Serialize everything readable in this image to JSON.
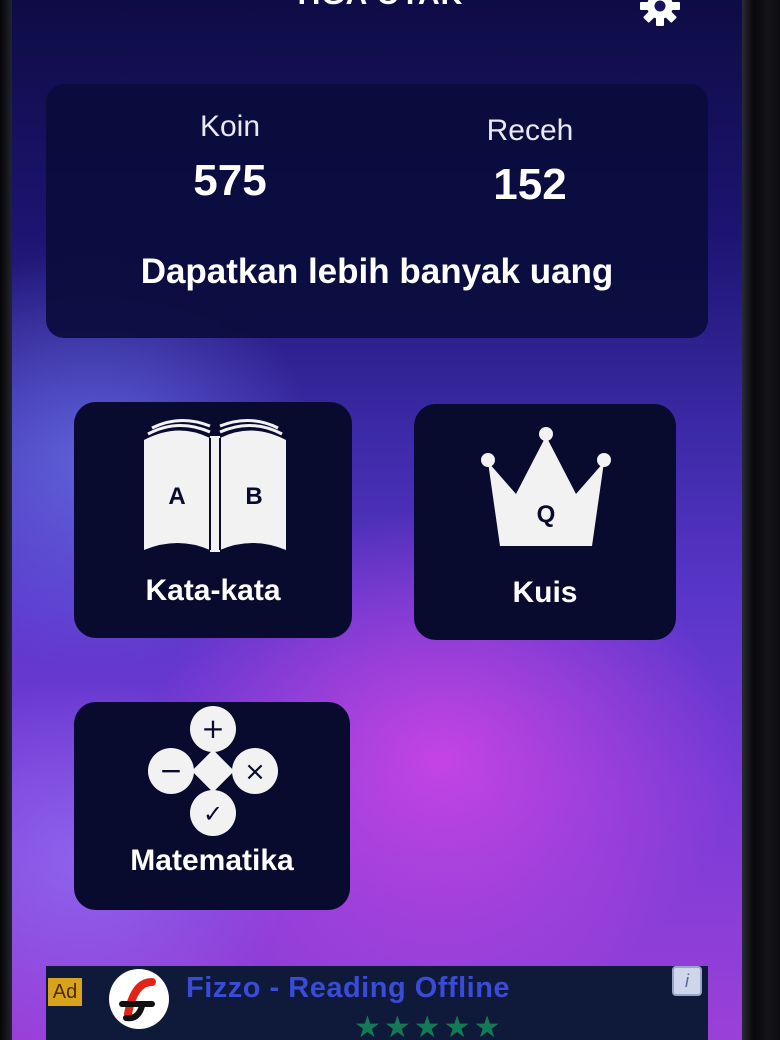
{
  "app": {
    "title": "TIGA OTAK"
  },
  "header": {
    "settings_icon": "gear-icon"
  },
  "stats": {
    "coin_label": "Koin",
    "coin_value": "575",
    "change_label": "Receh",
    "change_value": "152",
    "earn_more": "Dapatkan lebih banyak uang"
  },
  "modes": [
    {
      "label": "Kata-kata",
      "icon": "open-book-icon",
      "letters": [
        "A",
        "B"
      ]
    },
    {
      "label": "Kuis",
      "icon": "crown-icon",
      "letter": "Q"
    },
    {
      "label": "Matematika",
      "icon": "math-operations-icon",
      "symbols": [
        "+",
        "−",
        "×",
        "✓"
      ]
    }
  ],
  "ad": {
    "badge": "Ad",
    "title": "Fizzo - Reading Offline",
    "rating_stars": "★★★★★",
    "info": "i"
  },
  "colors": {
    "tile_bg": "#080a2e",
    "card_bg": "#0a0c3c",
    "ad_badge": "#d9a21b",
    "ad_title": "#3a4bd8",
    "stars": "#147a55"
  }
}
